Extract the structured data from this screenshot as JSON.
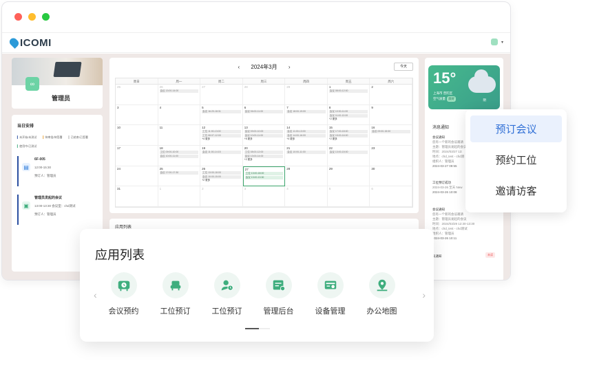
{
  "window": {
    "dots": [
      "#ff6159",
      "#ffbd2e",
      "#28c941"
    ]
  },
  "appbar": {
    "logo": "ICOMI"
  },
  "profile": {
    "name": "管理员",
    "avatar": "∞"
  },
  "today": {
    "title": "当日安排",
    "legend": [
      "未开始/未测试",
      "待审批/待签署",
      "已结束/已签署",
      "使用中/已测试"
    ],
    "events": [
      {
        "title": "6F-005",
        "time": "12:00-15:30",
        "booker": "预订人：管理员"
      },
      {
        "title": "管理员发起的会议",
        "time": "13:00-13:30 会议室：chd测试",
        "booker": "预订人：管理员"
      }
    ]
  },
  "calendar": {
    "title": "2024年3月",
    "prev": "‹",
    "next": "›",
    "today_button": "今天",
    "weekdays": [
      "周日",
      "周一",
      "周二",
      "周三",
      "周四",
      "周五",
      "周六"
    ],
    "weeks": [
      [
        {
          "d": "25"
        },
        {
          "d": "26",
          "ev": [
            "会议 13:00-14:00"
          ]
        },
        {
          "d": "27"
        },
        {
          "d": "28"
        },
        {
          "d": "29"
        },
        {
          "d": "1",
          "ev": [
            "会议 08:00-12:00"
          ]
        },
        {
          "d": "2"
        }
      ],
      [
        {
          "d": "3"
        },
        {
          "d": "4"
        },
        {
          "d": "5",
          "ev": [
            "会议 16:20-18:31"
          ]
        },
        {
          "d": "6",
          "ev": [
            "会议 06:00-11:00"
          ]
        },
        {
          "d": "7",
          "ev": [
            "会议 18:00-19:00"
          ]
        },
        {
          "d": "8",
          "ev": [
            "会议 10:30-11:00",
            "会议 11:00-12:00"
          ],
          "more": "+2 更多"
        },
        {
          "d": "9"
        }
      ],
      [
        {
          "d": "10"
        },
        {
          "d": "11"
        },
        {
          "d": "12",
          "ev": [
            "工位 11:00-13:00",
            "工位 08:07-12:00"
          ],
          "more": "+4 更多"
        },
        {
          "d": "13",
          "ev": [
            "会议 09:00-10:00",
            "会议 10:00-11:00"
          ],
          "more": "+5 更多"
        },
        {
          "d": "14",
          "ev": [
            "会议 11:00-13:00",
            "会议 14:00-16:00"
          ],
          "more": "+4 更多"
        },
        {
          "d": "15",
          "ev": [
            "会议 17:00-18:00",
            "会议 15:00-16:00"
          ],
          "more": "+2 更多"
        },
        {
          "d": "16",
          "ev": [
            "会议 09:00-15:00"
          ]
        }
      ],
      [
        {
          "d": "17"
        },
        {
          "d": "18",
          "ev": [
            "工位 09:00-10:00",
            "会议 10:00-11:00"
          ]
        },
        {
          "d": "19",
          "ev": [
            "会议 11:00-14:15"
          ]
        },
        {
          "d": "20",
          "ev": [
            "工位 08:00-12:00",
            "会议 13:00-14:00"
          ],
          "more": "+2 更多"
        },
        {
          "d": "21",
          "ev": [
            "会议 10:00-11:00"
          ]
        },
        {
          "d": "22",
          "ev": [
            "会议 13:00-15:00"
          ]
        },
        {
          "d": "23"
        }
      ],
      [
        {
          "d": "24"
        },
        {
          "d": "25",
          "ev": [
            "会议 17:00-17:30"
          ]
        },
        {
          "d": "26",
          "ev": [
            "工位 13:00-18:00",
            "会议 10:00-15:00"
          ],
          "more": "+2 更多"
        },
        {
          "d": "27",
          "ev": [
            "工位 13:00-18:00",
            "会议 13:00-13:30"
          ],
          "today": true
        },
        {
          "d": "28"
        },
        {
          "d": "29"
        },
        {
          "d": "30"
        }
      ],
      [
        {
          "d": "31"
        },
        {
          "d": "1"
        },
        {
          "d": "2"
        },
        {
          "d": "3"
        },
        {
          "d": "4"
        },
        {
          "d": "5"
        },
        {
          "d": "6"
        }
      ]
    ]
  },
  "applist_panel": {
    "title": "应用列表"
  },
  "weather": {
    "temp": "15°",
    "city": "上海市 普陀区",
    "aq_label": "空气质量",
    "aq_value": "良好",
    "cond": "阴"
  },
  "notices": {
    "title": "消息通知",
    "items": [
      {
        "head": "会议通知",
        "lines": [
          "您有一个新的会议邀请",
          "主题：管理员发起的会议",
          "时间：2024/03/27 13:",
          "地点：chd_test - chd测",
          "组织人：管理员"
        ],
        "time": "2024-03-27 09:55"
      },
      {
        "head": "工位预订成功",
        "lines": [
          "2024-03-26 至天 New"
        ],
        "time": "2024-03-26 10:08"
      },
      {
        "head": "会议通知",
        "lines": [
          "您有一个新的会议邀请",
          "主题：管理员发起的会议",
          "时间：2024/03/29 12:30-13:30",
          "地点：chd_test - chd测试",
          "组织人：管理员"
        ],
        "time": "2024-03-26 10:11"
      },
      {
        "head": "议通知",
        "lines": [],
        "time": ""
      }
    ],
    "badge": "未读"
  },
  "popup": {
    "items": [
      "预订会议",
      "预约工位",
      "邀请访客"
    ]
  },
  "card": {
    "title": "应用列表",
    "apps": [
      "会议预约",
      "工位预订",
      "工位预订",
      "管理后台",
      "设备管理",
      "办公地图"
    ],
    "prev": "‹",
    "next": "›"
  },
  "colors": {
    "accent": "#2f6fd6",
    "green": "#3fae7e"
  }
}
